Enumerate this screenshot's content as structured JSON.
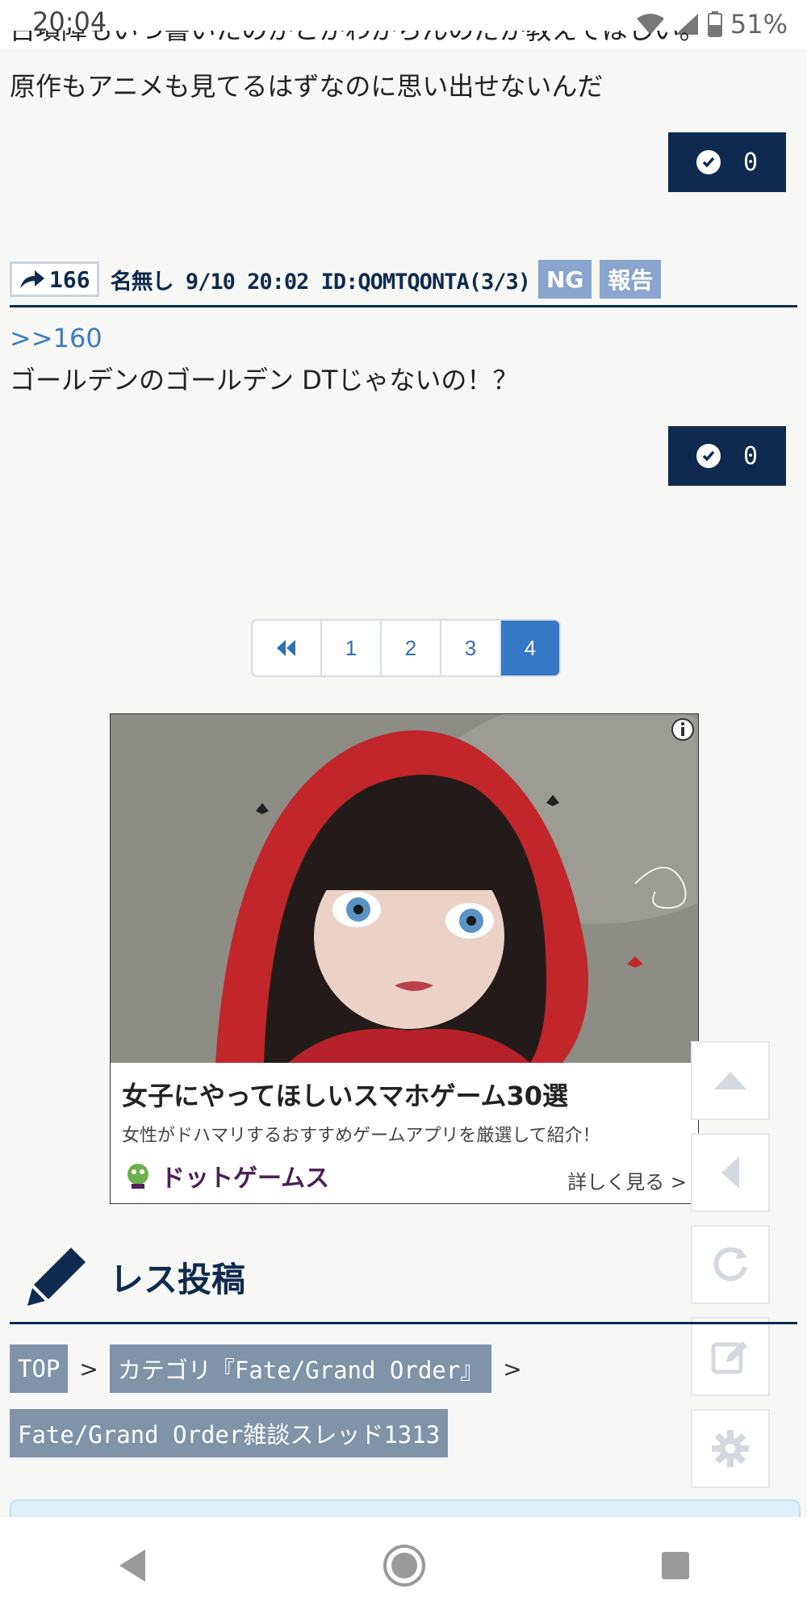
{
  "status_bar": {
    "time": "20:04",
    "battery": "51%"
  },
  "prev_post": {
    "text_cut": "古墳障もいつ書いたのかとかわからんのだが教えてほしい。",
    "text": "原作もアニメも見てるはずなのに思い出せないんだ",
    "vote_count": "0"
  },
  "post": {
    "number": "166",
    "meta": "名無し 9/10 20:02 ID:QOMTQONTA(3/3)",
    "ng_label": "NG",
    "report_label": "報告",
    "anchor": ">>160",
    "text": "ゴールデンのゴールデン DTじゃないの！？",
    "vote_count": "0"
  },
  "pagination": {
    "pages": [
      "1",
      "2",
      "3",
      "4"
    ],
    "active": "4"
  },
  "ad": {
    "title": "女子にやってほしいスマホゲーム30選",
    "description": "女性がドハマリするおすすめゲームアプリを厳選して紹介！",
    "brand": "ドットゲームス",
    "more_label": "詳しく見る >"
  },
  "reply_section": {
    "heading": "レス投稿"
  },
  "breadcrumb": {
    "top": "TOP",
    "sep": ">",
    "category": "カテゴリ『Fate/Grand Order』",
    "thread": "Fate/Grand Order雑談スレッド1313"
  },
  "icons": {
    "side_buttons": [
      "scroll-up-icon",
      "back-icon",
      "reload-icon",
      "edit-icon",
      "settings-icon"
    ],
    "nav": [
      "nav-back-icon",
      "nav-home-icon",
      "nav-recents-icon"
    ]
  },
  "colors": {
    "navy": "#0e2b4f",
    "accent_blue": "#3478c6",
    "chip_blue": "#8aa6cf",
    "crumb_gray": "#7f93a9"
  }
}
